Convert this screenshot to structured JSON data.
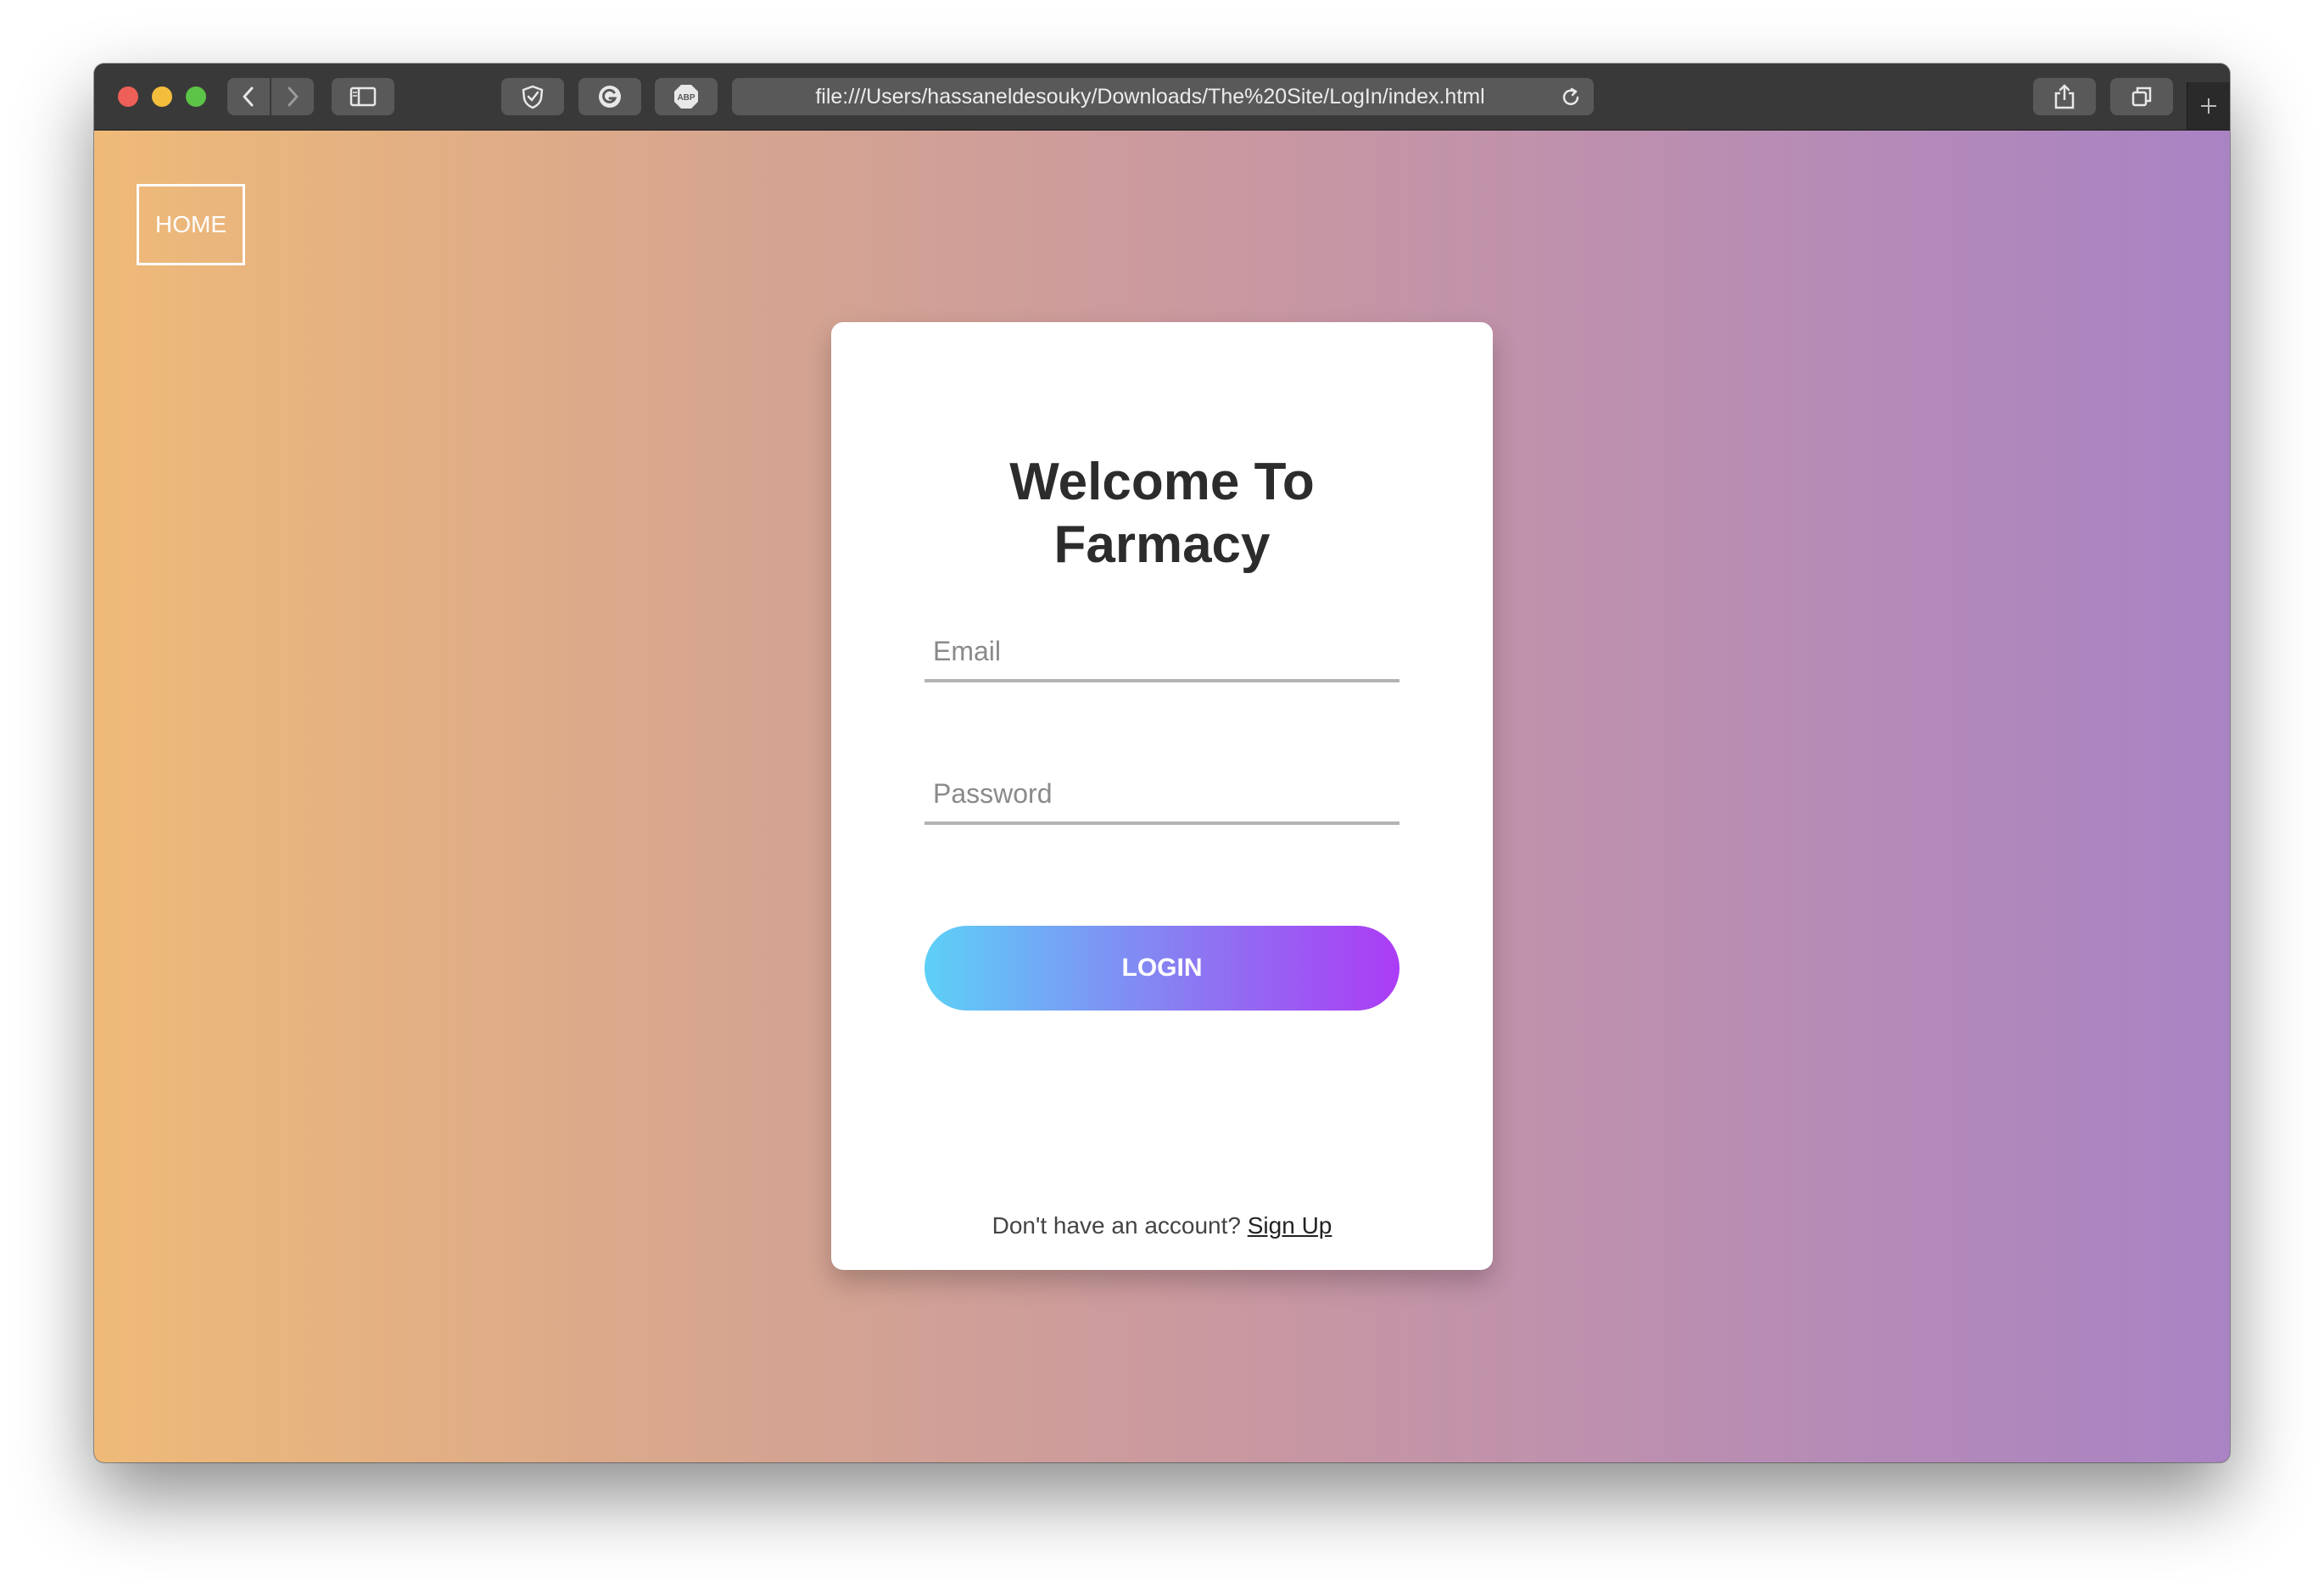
{
  "browser": {
    "url": "file:///Users/hassaneldesouky/Downloads/The%20Site/LogIn/index.html",
    "colors": {
      "toolbar": "#3a3939",
      "button": "#5a5959",
      "close": "#ee5f57",
      "minimize": "#f4bd3c",
      "maximize": "#5cc447"
    },
    "icons": [
      "back-icon",
      "forward-icon",
      "sidebar-icon",
      "shield-extension-icon",
      "grammarly-icon",
      "adblock-icon",
      "reload-icon",
      "share-icon",
      "tabs-overview-icon",
      "new-tab-icon"
    ]
  },
  "nav": {
    "home_label": "HOME"
  },
  "login": {
    "title": "Welcome To Farmacy",
    "email_placeholder": "Email",
    "password_placeholder": "Password",
    "login_label": "LOGIN",
    "signup_prompt": "Don't have an account?",
    "signup_link": "Sign Up"
  },
  "colors": {
    "background_start": "#efba78",
    "background_end": "#a983c4",
    "button_start": "#5dd0f7",
    "button_end": "#ab3cf5"
  }
}
